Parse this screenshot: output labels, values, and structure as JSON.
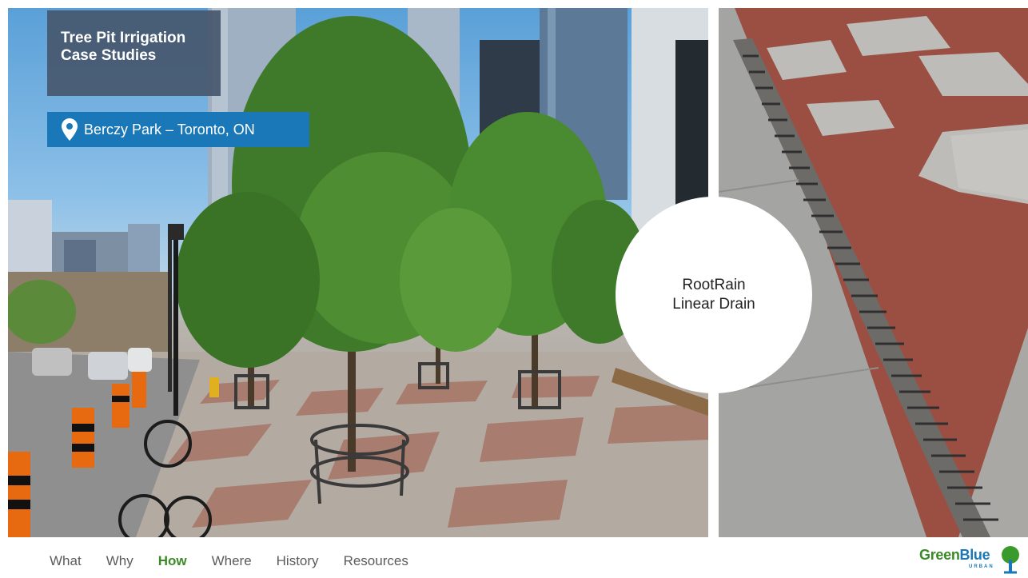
{
  "slide": {
    "title_lines": [
      "Tree Pit Irrigation",
      "Case Studies"
    ],
    "location": "Berczy Park – Toronto, ON",
    "callout_lines": [
      "RootRain",
      "Linear Drain"
    ]
  },
  "nav": {
    "items": [
      {
        "label": "What",
        "active": false
      },
      {
        "label": "Why",
        "active": false
      },
      {
        "label": "How",
        "active": true
      },
      {
        "label": "Where",
        "active": false
      },
      {
        "label": "History",
        "active": false
      },
      {
        "label": "Resources",
        "active": false
      }
    ]
  },
  "logo": {
    "word_green": "Green",
    "word_blue": "Blue",
    "sub": "URBAN"
  },
  "colors": {
    "title_box": "#46576e",
    "location_bar": "#1a78b8",
    "nav_active": "#3a8a26",
    "nav_text": "#5b5b5b"
  },
  "icons": {
    "location": "map-pin-icon",
    "logo_mark": "tree-logo-icon"
  }
}
